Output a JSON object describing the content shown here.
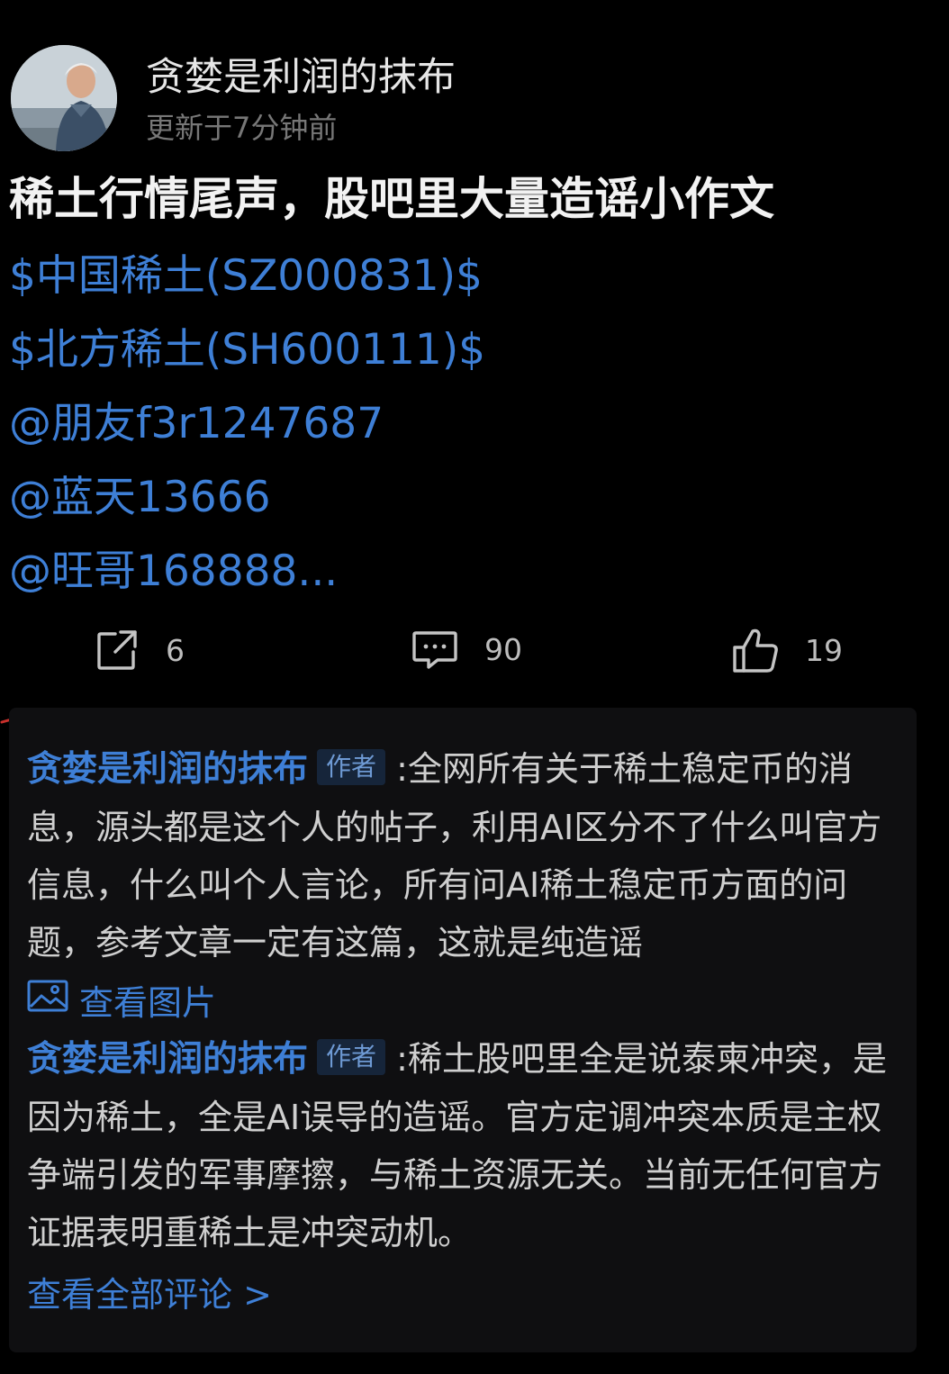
{
  "post": {
    "author": "贪婪是利润的抹布",
    "updated": "更新于7分钟前",
    "title": "稀土行情尾声，股吧里大量造谣小作文",
    "links": [
      "$中国稀土(SZ000831)$",
      "$北方稀土(SH600111)$",
      "@朋友f3r1247687",
      "@蓝天13666",
      "@旺哥168888..."
    ]
  },
  "actions": {
    "share_count": "6",
    "comment_count": "90",
    "like_count": "19"
  },
  "comments": [
    {
      "author": "贪婪是利润的抹布",
      "badge": "作者",
      "separator": ":",
      "text": "全网所有关于稀土稳定币的消息，源头都是这个人的帖子，利用AI区分不了什么叫官方信息，什么叫个人言论，所有问AI稀土稳定币方面的问题，参考文章一定有这篇，这就是纯造谣",
      "view_image_label": "查看图片"
    },
    {
      "author": "贪婪是利润的抹布",
      "badge": "作者",
      "separator": ":",
      "text": "稀土股吧里全是说泰柬冲突，是因为稀土，全是AI误导的造谣。官方定调冲突本质是主权争端引发的军事摩擦，与稀土资源无关。当前无任何官方证据表明重稀土是冲突动机。"
    }
  ],
  "view_all_comments": "查看全部评论 >",
  "colors": {
    "background": "#000000",
    "link": "#3e7fd6",
    "comment_panel": "#0f0f11",
    "muted": "#777777"
  },
  "icons": {
    "share": "share-icon",
    "comment": "comment-icon",
    "like": "thumbs-up-icon",
    "image": "image-icon"
  }
}
